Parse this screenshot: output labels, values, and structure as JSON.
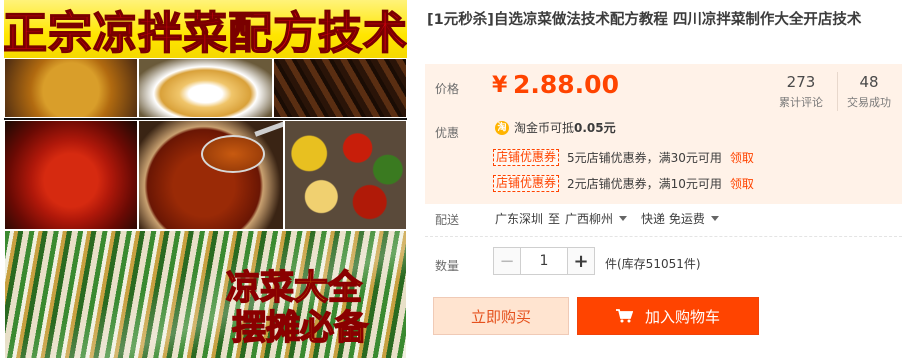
{
  "gallery": {
    "banner_top": "正宗凉拌菜配方技术",
    "banner_bottom_line1": "凉菜大全",
    "banner_bottom_line2": "摆摊必备"
  },
  "product": {
    "title": "[1元秒杀]自选凉菜做法技术配方教程 四川凉拌菜制作大全开店技术"
  },
  "price": {
    "label": "价格",
    "currency": "¥",
    "amount": "2.88.00"
  },
  "stats": {
    "reviews_count": "273",
    "reviews_label": "累计评论",
    "deals_count": "48",
    "deals_label": "交易成功"
  },
  "promo": {
    "label": "优惠",
    "coin_icon": "淘",
    "coin_text": "淘金币可抵",
    "coin_amount": "0.05元",
    "coupons": [
      {
        "tag": "店铺优惠券",
        "text": "5元店铺优惠券，满30元可用",
        "claim": "领取"
      },
      {
        "tag": "店铺优惠券",
        "text": "2元店铺优惠券，满10元可用",
        "claim": "领取"
      }
    ]
  },
  "shipping": {
    "label": "配送",
    "from": "广东深圳",
    "to_word": "至",
    "to": "广西柳州",
    "method": "快递 免运费"
  },
  "quantity": {
    "label": "数量",
    "minus": "−",
    "value": "1",
    "plus": "+",
    "stock": "件(库存51051件)"
  },
  "actions": {
    "buy_now": "立即购买",
    "add_to_cart": "加入购物车"
  },
  "colors": {
    "accent": "#ff4400",
    "price_bg": "#fff2e8",
    "buy_now_bg": "#ffe4d0"
  }
}
